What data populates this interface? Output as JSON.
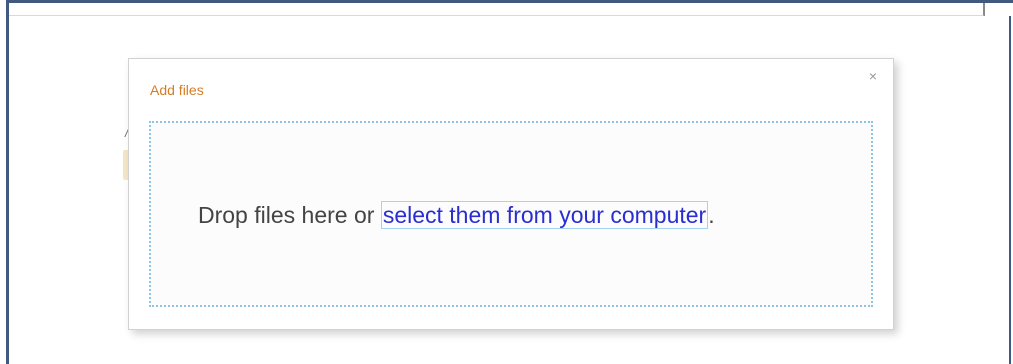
{
  "dialog": {
    "title": "Add files",
    "close_label": "×",
    "drop_prefix": "Drop files here or ",
    "drop_link": "select them from your computer",
    "drop_suffix": "."
  },
  "background": {
    "fragment_text": "/"
  },
  "colors": {
    "title": "#d57d25",
    "link": "#2a2ed0",
    "dotted_border": "#8fc3e5",
    "frame": "#41597f"
  }
}
